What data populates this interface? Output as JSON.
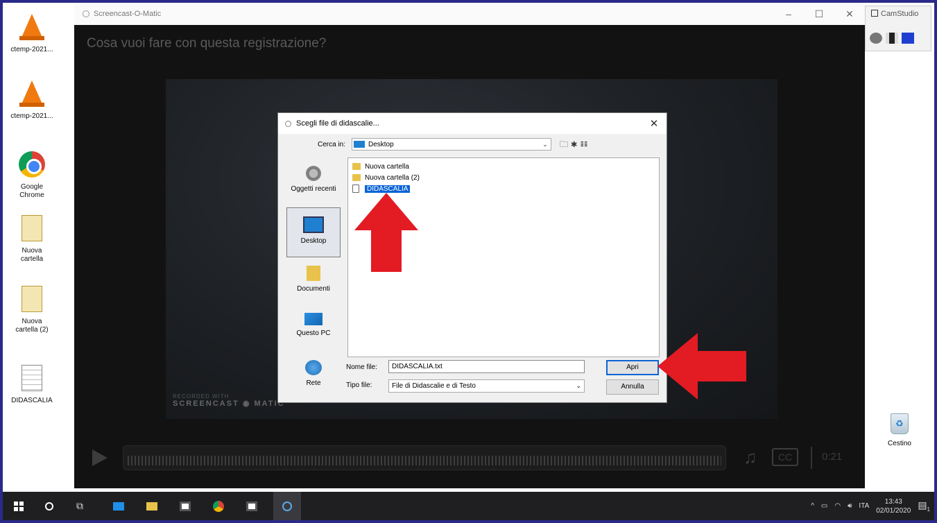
{
  "desktop": {
    "icons": [
      {
        "label": "ctemp-2021..."
      },
      {
        "label": "ctemp-2021..."
      },
      {
        "label": "Google Chrome"
      },
      {
        "label": "Nuova cartella"
      },
      {
        "label": "Nuova cartella (2)"
      },
      {
        "label": "DIDASCALIA"
      }
    ],
    "recycle_bin": "Cestino"
  },
  "camstudio": {
    "title": "CamStudio"
  },
  "screencast": {
    "window_title": "Screencast-O-Matic",
    "prompt": "Cosa vuoi fare con questa registrazione?",
    "watermark_line1": "RECORDED WITH",
    "watermark_line2": "SCREENCAST  ◉  MATIC",
    "player": {
      "time": "0:21",
      "cc_label": "CC"
    }
  },
  "dialog": {
    "title": "Scegli file di didascalie...",
    "look_in_label": "Cerca in:",
    "look_in_value": "Desktop",
    "places": [
      {
        "label": "Oggetti recenti"
      },
      {
        "label": "Desktop"
      },
      {
        "label": "Documenti"
      },
      {
        "label": "Questo PC"
      },
      {
        "label": "Rete"
      }
    ],
    "files": [
      {
        "name": "Nuova cartella",
        "kind": "folder"
      },
      {
        "name": "Nuova cartella (2)",
        "kind": "folder"
      },
      {
        "name": "DIDASCALIA",
        "kind": "text"
      }
    ],
    "filename_label": "Nome file:",
    "filename_value": "DIDASCALIA.txt",
    "filetype_label": "Tipo file:",
    "filetype_value": "File di Didascalie e di Testo",
    "open_label": "Apri",
    "cancel_label": "Annulla"
  },
  "taskbar": {
    "language": "ITA",
    "time": "13:43",
    "date": "02/01/2020",
    "notification_count": "1"
  },
  "colors": {
    "accent_blue": "#0a64d6",
    "arrow_red": "#e31b23",
    "frame_border": "#2a2a8a"
  }
}
